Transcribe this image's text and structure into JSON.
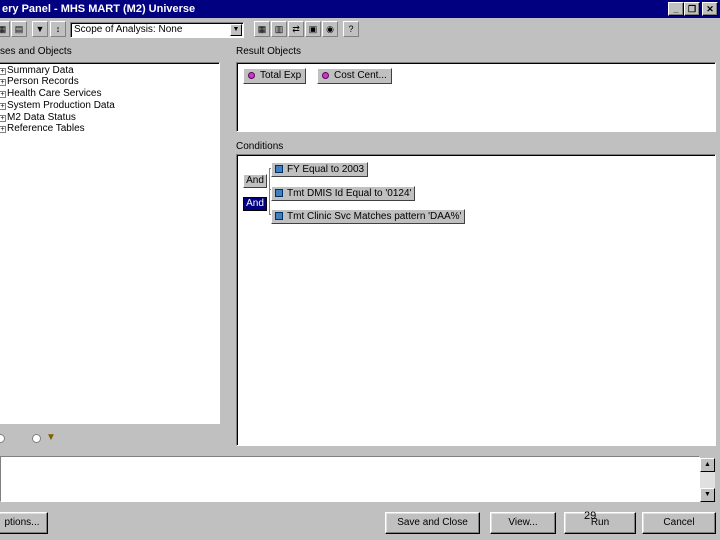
{
  "window": {
    "title": "ery Panel - MHS MART (M2) Universe",
    "minimize_glyph": "_",
    "maximize_glyph": "❐",
    "close_glyph": "✕"
  },
  "toolbar": {
    "scope_combo_value": "Scope of Analysis: None",
    "icons": [
      "table-icon",
      "filter-icon",
      "sort-icon",
      "calculator-icon",
      "grid-icon",
      "swap-icon",
      "table-alt-icon",
      "sql-icon",
      "help-icon"
    ]
  },
  "left_panel": {
    "label": "ses and Objects",
    "tree_items": [
      "Summary Data",
      "Person Records",
      "Health Care Services",
      "System Production Data",
      "M2 Data Status",
      "Reference Tables"
    ]
  },
  "result_objects": {
    "label": "Result Objects",
    "items": [
      "Total Exp",
      "Cost Cent..."
    ]
  },
  "conditions": {
    "label": "Conditions",
    "and_labels": [
      "And",
      "And"
    ],
    "items": [
      "FY Equal to 2003",
      "Tmt DMIS Id Equal to '0124'",
      "Tmt Clinic Svc Matches pattern 'DAA%'"
    ]
  },
  "buttons": {
    "options": "ptions...",
    "save_close": "Save and Close",
    "view": "View...",
    "run": "Run",
    "cancel": "Cancel"
  },
  "page_number": "29"
}
